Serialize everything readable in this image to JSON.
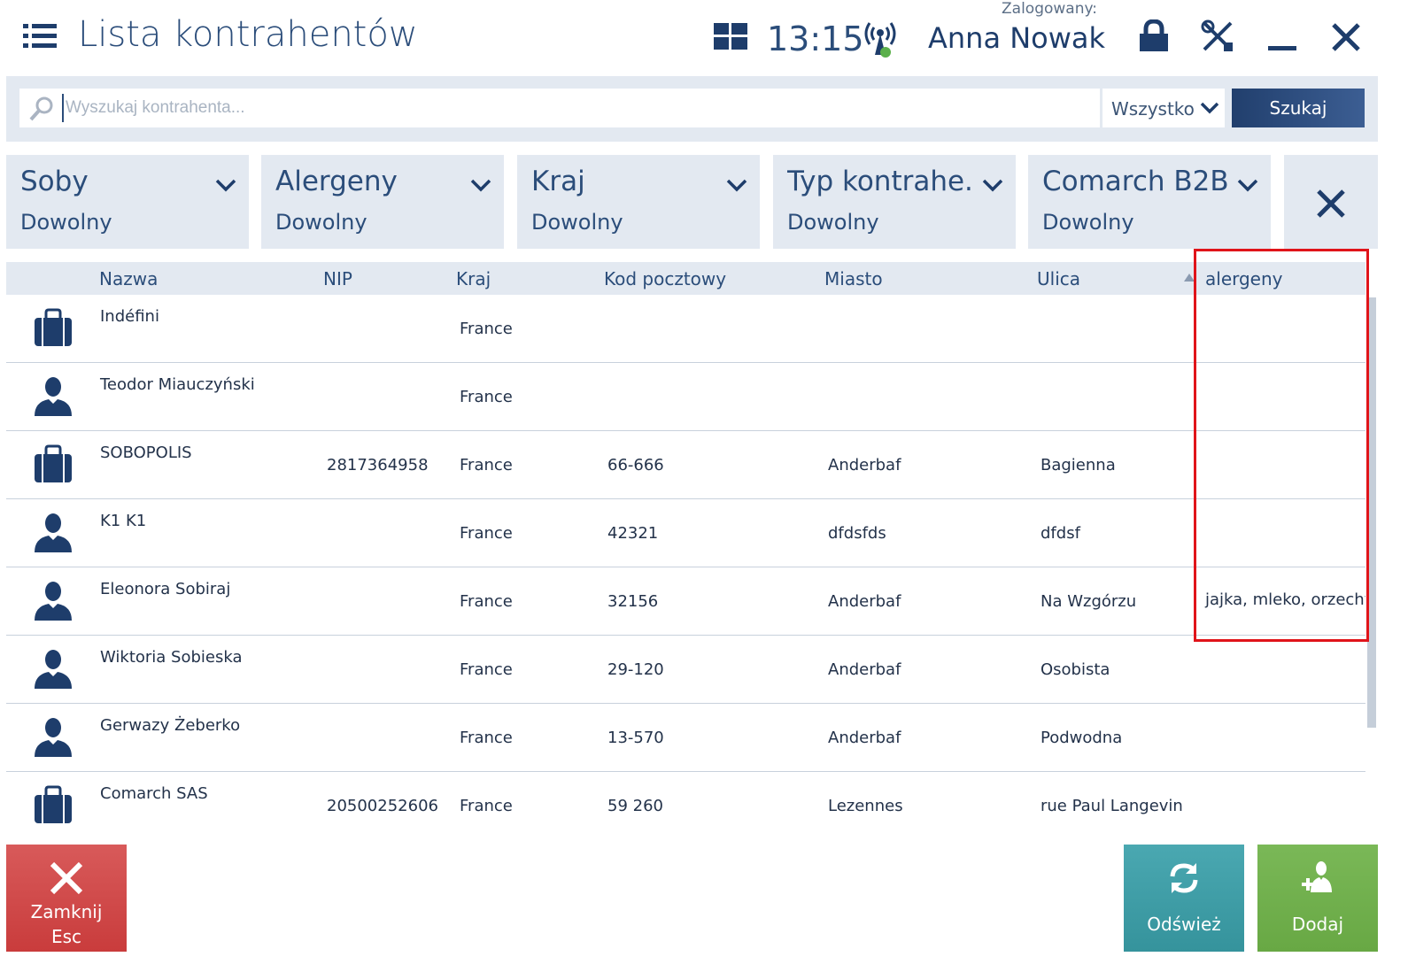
{
  "header": {
    "title": "Lista kontrahentów",
    "time": "13:15",
    "logged_label": "Zalogowany:",
    "user_name": "Anna Nowak",
    "icons": [
      "menu-icon",
      "tiles-icon",
      "signal-icon",
      "lock-icon",
      "tools-icon",
      "minimize-icon",
      "close-icon"
    ]
  },
  "search": {
    "placeholder": "Wyszukaj kontrahenta...",
    "scope_value": "Wszystko",
    "button_label": "Szukaj"
  },
  "filters": [
    {
      "title": "Soby",
      "value": "Dowolny"
    },
    {
      "title": "Alergeny",
      "value": "Dowolny"
    },
    {
      "title": "Kraj",
      "value": "Dowolny"
    },
    {
      "title": "Typ kontrahe...",
      "value": "Dowolny"
    },
    {
      "title": "Comarch B2B",
      "value": "Dowolny"
    }
  ],
  "table": {
    "columns": [
      "Nazwa",
      "NIP",
      "Kraj",
      "Kod pocztowy",
      "Miasto",
      "Ulica",
      "alergeny"
    ],
    "sorted_column": "Ulica",
    "rows": [
      {
        "type": "company",
        "name": "Indéfini",
        "nip": "",
        "kraj": "France",
        "kod": "",
        "miasto": "",
        "ulica": "",
        "alergeny": ""
      },
      {
        "type": "person",
        "name": "Teodor Miauczyński",
        "nip": "",
        "kraj": "France",
        "kod": "",
        "miasto": "",
        "ulica": "",
        "alergeny": ""
      },
      {
        "type": "company",
        "name": "SOBOPOLIS",
        "nip": "2817364958",
        "kraj": "France",
        "kod": "66-666",
        "miasto": "Anderbaf",
        "ulica": "Bagienna",
        "alergeny": ""
      },
      {
        "type": "person",
        "name": "K1 K1",
        "nip": "",
        "kraj": "France",
        "kod": "42321",
        "miasto": "dfdsfds",
        "ulica": "dfdsf",
        "alergeny": ""
      },
      {
        "type": "person",
        "name": "Eleonora Sobiraj",
        "nip": "",
        "kraj": "France",
        "kod": "32156",
        "miasto": "Anderbaf",
        "ulica": "Na Wzgórzu",
        "alergeny": "jajka, mleko, orzechy"
      },
      {
        "type": "person",
        "name": "Wiktoria Sobieska",
        "nip": "",
        "kraj": "France",
        "kod": "29-120",
        "miasto": "Anderbaf",
        "ulica": "Osobista",
        "alergeny": ""
      },
      {
        "type": "person",
        "name": "Gerwazy Żeberko",
        "nip": "",
        "kraj": "France",
        "kod": "13-570",
        "miasto": "Anderbaf",
        "ulica": "Podwodna",
        "alergeny": ""
      },
      {
        "type": "company",
        "name": "Comarch SAS",
        "nip": "20500252606",
        "kraj": "France",
        "kod": "59 260",
        "miasto": "Lezennes",
        "ulica": "rue Paul Langevin",
        "alergeny": ""
      }
    ]
  },
  "footer": {
    "close_label": "Zamknij",
    "close_shortcut": "Esc",
    "refresh_label": "Odśwież",
    "add_label": "Dodaj"
  },
  "colors": {
    "primary": "#1e3d6b",
    "panel": "#e3e9f1",
    "close_button": "#c93c3c",
    "refresh_button": "#35939c",
    "add_button": "#68a844",
    "highlight": "#e0141a"
  }
}
